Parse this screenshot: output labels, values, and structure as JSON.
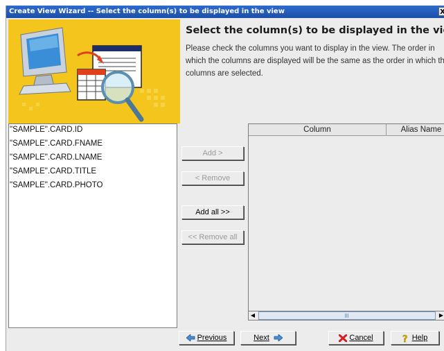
{
  "window": {
    "title": "Create View Wizard -- Select the column(s) to be displayed in the view",
    "close_label": "X"
  },
  "page": {
    "heading": "Select the column(s) to be displayed in the view.",
    "description": "Please check the columns you want to display in the view. The order in which the columns are displayed will be the same as the order in which the columns are selected."
  },
  "available_columns": [
    "\"SAMPLE\".CARD.ID",
    "\"SAMPLE\".CARD.FNAME",
    "\"SAMPLE\".CARD.LNAME",
    "\"SAMPLE\".CARD.TITLE",
    "\"SAMPLE\".CARD.PHOTO"
  ],
  "buttons": {
    "add": "Add >",
    "remove": "< Remove",
    "add_all": "Add all >>",
    "remove_all": "<< Remove all"
  },
  "selected_table": {
    "columns": [
      "Column",
      "Alias Name"
    ],
    "rows": []
  },
  "footer": {
    "previous": "Previous",
    "next": "Next",
    "cancel": "Cancel",
    "help": "Help"
  },
  "icons": {
    "previous": "arrow-left-icon",
    "next": "arrow-right-icon",
    "cancel": "red-x-icon",
    "help": "question-icon"
  },
  "colors": {
    "titlebar": "#1c4fa8",
    "banner": "#f3c51d",
    "dialog_bg": "#ececec"
  }
}
